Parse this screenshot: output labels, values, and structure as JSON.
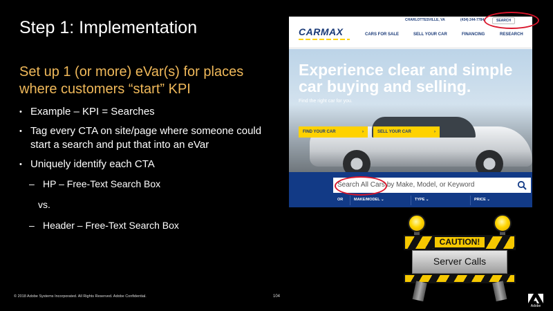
{
  "slide": {
    "title": "Step 1: Implementation",
    "heading": "Set up 1 (or more) eVar(s) for places where customers “start” KPI",
    "bullets": {
      "b1": "Example – KPI = Searches",
      "b2": "Tag every CTA on site/page where someone could start a search and put that into an eVar",
      "b3": "Uniquely identify each CTA",
      "sub1": "HP – Free-Text Search Box",
      "vs": "vs.",
      "sub2": "Header – Free-Text Search Box",
      "dash": "–"
    },
    "footer": "© 2018 Adobe Systems Incorporated.  All Rights Reserved.  Adobe Confidential.",
    "page_number": "104",
    "logo_text": "Adobe"
  },
  "site": {
    "brand": "CARMAX",
    "location": "CHARLOTTESVILLE, VA",
    "phone": "(434) 244-7784",
    "search_link": "SEARCH",
    "nav": [
      "CARS FOR SALE",
      "SELL YOUR CAR",
      "FINANCING",
      "RESEARCH"
    ],
    "hero_headline": "Experience clear and simple car buying and selling.",
    "hero_sub": "Find the right car for you.",
    "buttons": {
      "find": "FIND YOUR CAR",
      "sell": "SELL YOUR CAR",
      "arrow": "›"
    },
    "search_placeholder": "Search All Cars by Make, Model, or Keyword",
    "filters": [
      "OR",
      "MAKE/MODEL ⌄",
      "TYPE ⌄",
      "PRICE ⌄"
    ]
  },
  "sign": {
    "caution": "CAUTION!",
    "label": "Server Calls"
  },
  "colors": {
    "heading": "#f0b95a",
    "carmax_blue": "#1a3a78",
    "carmax_yellow": "#ffd200",
    "annotation_red": "#d9152b"
  }
}
